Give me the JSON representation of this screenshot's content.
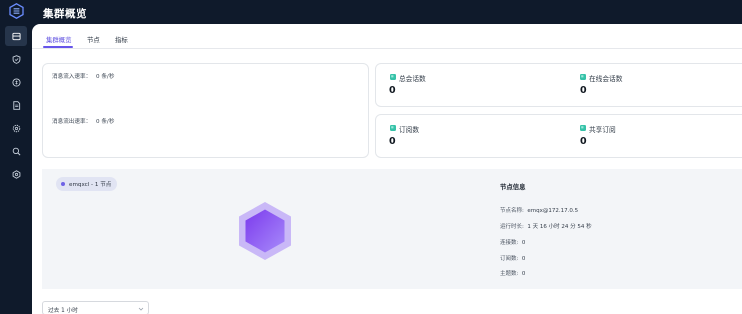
{
  "header": {
    "title": "集群概览"
  },
  "sidebar": {
    "items": [
      {
        "icon": "dashboard-icon",
        "active": true
      },
      {
        "icon": "shield-icon",
        "active": false
      },
      {
        "icon": "coin-icon",
        "active": false
      },
      {
        "icon": "document-icon",
        "active": false
      },
      {
        "icon": "gear-icon",
        "active": false
      },
      {
        "icon": "search-icon",
        "active": false
      },
      {
        "icon": "plugin-icon",
        "active": false
      }
    ]
  },
  "tabs": [
    {
      "label": "集群概览",
      "active": true
    },
    {
      "label": "节点",
      "active": false
    },
    {
      "label": "指标",
      "active": false
    }
  ],
  "rates": {
    "inflow_label": "消息流入速率：",
    "inflow_value": "0 条/秒",
    "outflow_label": "消息流出速率：",
    "outflow_value": "0 条/秒"
  },
  "stats": {
    "total_sessions": {
      "label": "总会话数",
      "value": "0"
    },
    "online_sessions": {
      "label": "在线会话数",
      "value": "0"
    },
    "subscriptions": {
      "label": "订阅数",
      "value": "0"
    },
    "shared_subscriptions": {
      "label": "共享订阅",
      "value": "0"
    }
  },
  "node": {
    "tag": "emqxcl - 1 节点",
    "info_title": "节点信息",
    "rows": [
      {
        "key": "节点名称:",
        "value": "emqx@172.17.0.5"
      },
      {
        "key": "运行时长:",
        "value": "1 天 16 小时 24 分 54 秒"
      },
      {
        "key": "连接数:",
        "value": "0"
      },
      {
        "key": "订阅数:",
        "value": "0"
      },
      {
        "key": "主题数:",
        "value": "0"
      }
    ]
  },
  "time_select": {
    "value": "过去 1 小时"
  },
  "colors": {
    "accent": "#6655ea",
    "sidebar_bg": "#0f1a2b",
    "stat_icon_teal": "#36c2a8",
    "hexagon_fill": "#8b5cf6"
  }
}
